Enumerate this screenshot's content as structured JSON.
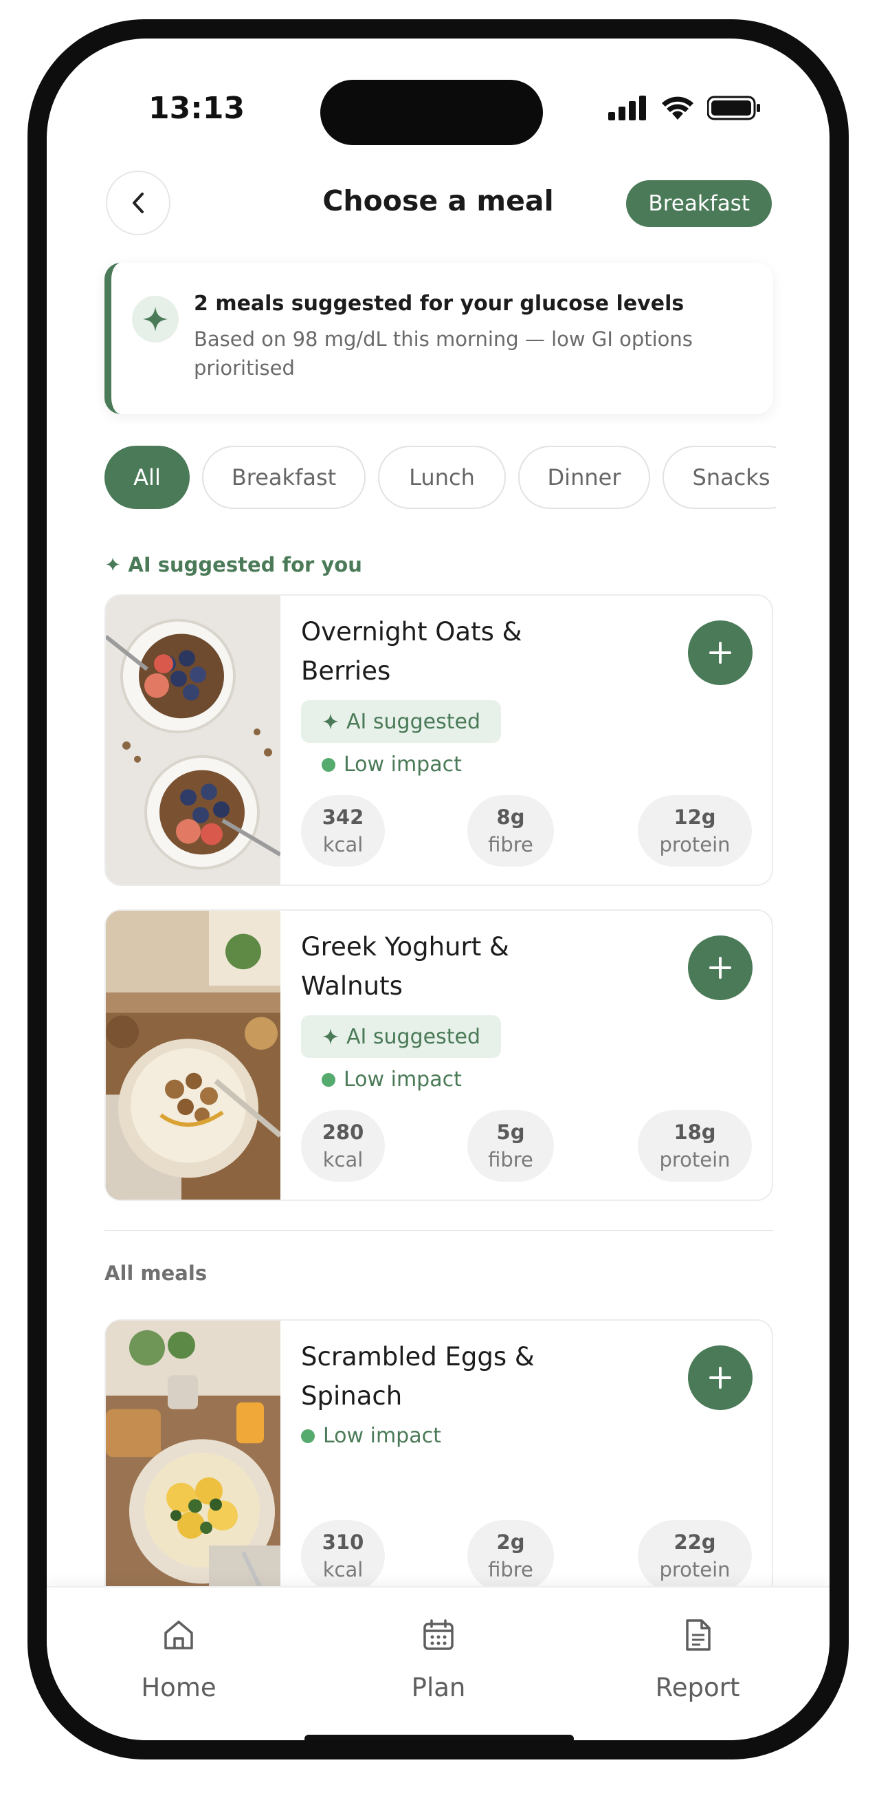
{
  "status_bar": {
    "time": "13:13"
  },
  "header": {
    "title": "Choose a meal",
    "meal_badge": "Breakfast"
  },
  "banner": {
    "title": "2 meals suggested for your glucose levels",
    "subtitle": "Based on 98 mg/dL this morning — low GI options prioritised"
  },
  "filters": [
    "All",
    "Breakfast",
    "Lunch",
    "Dinner",
    "Snacks"
  ],
  "sections": {
    "ai": "✦ AI suggested for you",
    "all": "All meals"
  },
  "colors": {
    "accent": "#4a7a57",
    "accent_light": "#e7f1ea",
    "impact_dot": "#55aa6d"
  },
  "meals": [
    {
      "name": "Overnight Oats & Berries",
      "ai_tag": "AI suggested",
      "impact": "Low impact",
      "kcal": "342",
      "kcal_label": "kcal",
      "fibre": "8g",
      "fibre_label": "fibre",
      "protein": "12g",
      "protein_label": "protein"
    },
    {
      "name": "Greek Yoghurt & Walnuts",
      "ai_tag": "AI suggested",
      "impact": "Low impact",
      "kcal": "280",
      "kcal_label": "kcal",
      "fibre": "5g",
      "fibre_label": "fibre",
      "protein": "18g",
      "protein_label": "protein"
    },
    {
      "name": "Scrambled Eggs & Spinach",
      "impact": "Low impact",
      "kcal": "310",
      "kcal_label": "kcal",
      "fibre": "2g",
      "fibre_label": "fibre",
      "protein": "22g",
      "protein_label": "protein"
    }
  ],
  "nav": [
    {
      "label": "Home",
      "icon": "home-icon"
    },
    {
      "label": "Plan",
      "icon": "calendar-icon"
    },
    {
      "label": "Report",
      "icon": "document-icon"
    }
  ]
}
